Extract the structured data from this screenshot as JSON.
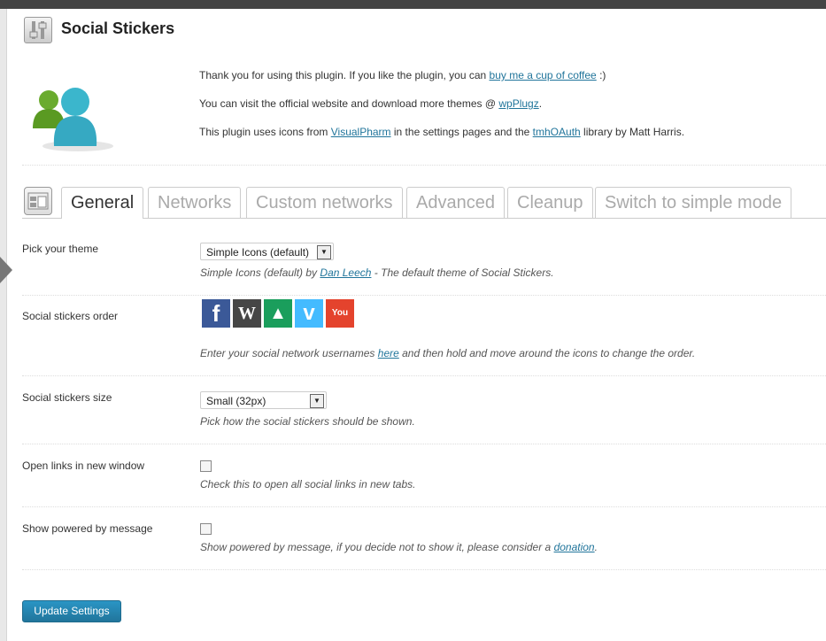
{
  "page": {
    "title": "Social Stickers"
  },
  "intro": {
    "line1_pre": "Thank you for using this plugin. If you like the plugin, you can ",
    "line1_link": "buy me a cup of coffee",
    "line1_post": " :)",
    "line2_pre": "You can visit the official website and download more themes @ ",
    "line2_link": "wpPlugz",
    "line2_post": ".",
    "line3_pre": "This plugin uses icons from ",
    "line3_link1": "VisualPharm",
    "line3_mid": " in the settings pages and the ",
    "line3_link2": "tmhOAuth",
    "line3_post": " library by Matt Harris."
  },
  "tabs": [
    "General",
    "Networks",
    "Custom networks",
    "Advanced",
    "Cleanup",
    "Switch to simple mode"
  ],
  "settings": {
    "theme": {
      "label": "Pick your theme",
      "value": "Simple Icons (default)",
      "desc_pre": "Simple Icons (default) by ",
      "desc_link": "Dan Leech",
      "desc_post": " - The default theme of Social Stickers."
    },
    "order": {
      "label": "Social stickers order",
      "stickers": [
        {
          "name": "facebook",
          "glyph": "f",
          "color": "#3b5998"
        },
        {
          "name": "wordpress",
          "glyph": "W",
          "color": "#464646"
        },
        {
          "name": "forrst",
          "glyph": "▲",
          "color": "#1a9e5c"
        },
        {
          "name": "vimeo",
          "glyph": "v",
          "color": "#44bbff"
        },
        {
          "name": "youtube",
          "glyph": "You",
          "color": "#e4432d"
        }
      ],
      "desc_pre": "Enter your social network usernames ",
      "desc_link": "here",
      "desc_post": " and then hold and move around the icons to change the order."
    },
    "size": {
      "label": "Social stickers size",
      "value": "Small (32px)",
      "desc": "Pick how the social stickers should be shown."
    },
    "new_window": {
      "label": "Open links in new window",
      "checked": false,
      "desc": "Check this to open all social links in new tabs."
    },
    "powered_by": {
      "label": "Show powered by message",
      "checked": false,
      "desc_pre": "Show powered by message, if you decide not to show it, please consider a ",
      "desc_link": "donation",
      "desc_post": "."
    }
  },
  "button": {
    "label": "Update Settings"
  }
}
